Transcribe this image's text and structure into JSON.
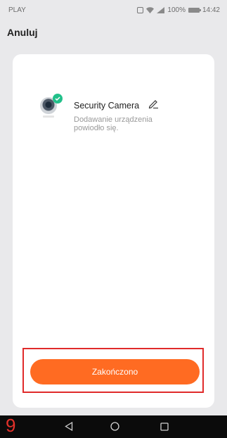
{
  "status_bar": {
    "carrier": "PLAY",
    "battery_percent": "100%",
    "time": "14:42"
  },
  "header": {
    "cancel_label": "Anuluj"
  },
  "device": {
    "name": "Security Camera",
    "status": "Dodawanie urządzenia powiodło się.",
    "icon": "camera-icon",
    "badge_icon": "check-icon"
  },
  "finish_button": {
    "label": "Zakończono"
  },
  "annotation": {
    "step_number": "9"
  },
  "colors": {
    "accent": "#ff6b22",
    "success": "#22c08a",
    "highlight": "#e02b2b",
    "background": "#e9e9eb"
  }
}
